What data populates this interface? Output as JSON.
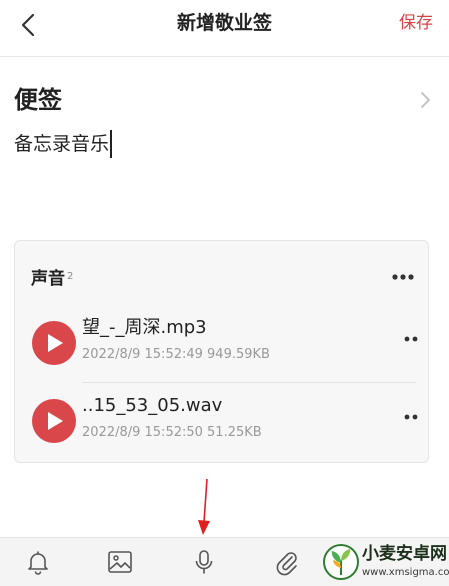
{
  "header": {
    "title": "新增敬业签",
    "save_label": "保存"
  },
  "note": {
    "category": "便签",
    "body": "备忘录音乐"
  },
  "sound_card": {
    "heading": "声音",
    "count": "2",
    "tracks": [
      {
        "name": "望_-_周深.mp3",
        "meta": "2022/8/9 15:52:49 949.59KB"
      },
      {
        "name": "..15_53_05.wav",
        "meta": "2022/8/9 15:52:50 51.25KB"
      }
    ]
  },
  "toolbar": {
    "icons": [
      "bell-icon",
      "image-icon",
      "microphone-icon",
      "paperclip-icon"
    ]
  },
  "watermark": {
    "text": "小麦安卓网",
    "url": "www.xmsigma.com"
  },
  "colors": {
    "accent": "#d64545",
    "play": "#d9474a",
    "arrow": "#e02020"
  }
}
